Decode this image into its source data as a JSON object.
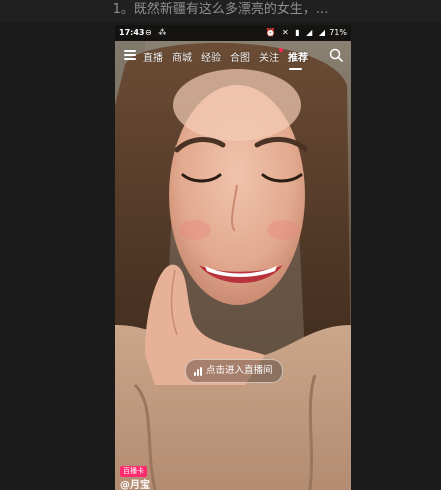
{
  "caption": "1。既然新疆有这么多漂亮的女生，...",
  "status_bar": {
    "time": "17:43",
    "battery": "71%"
  },
  "nav": {
    "tabs": [
      {
        "label": "直播",
        "active": false
      },
      {
        "label": "商城",
        "active": false
      },
      {
        "label": "经验",
        "active": false
      },
      {
        "label": "合图",
        "active": false
      },
      {
        "label": "关注",
        "active": false
      },
      {
        "label": "推荐",
        "active": true
      }
    ],
    "menu_icon": "menu-icon",
    "search_icon": "search-icon"
  },
  "live": {
    "enter_label": "点击进入直播间",
    "icon": "live-bars-icon"
  },
  "badge": {
    "label": "百播卡"
  },
  "author": {
    "name": "@月宝"
  },
  "colors": {
    "accent": "#ff2b6e",
    "background": "#1b1b1b"
  }
}
